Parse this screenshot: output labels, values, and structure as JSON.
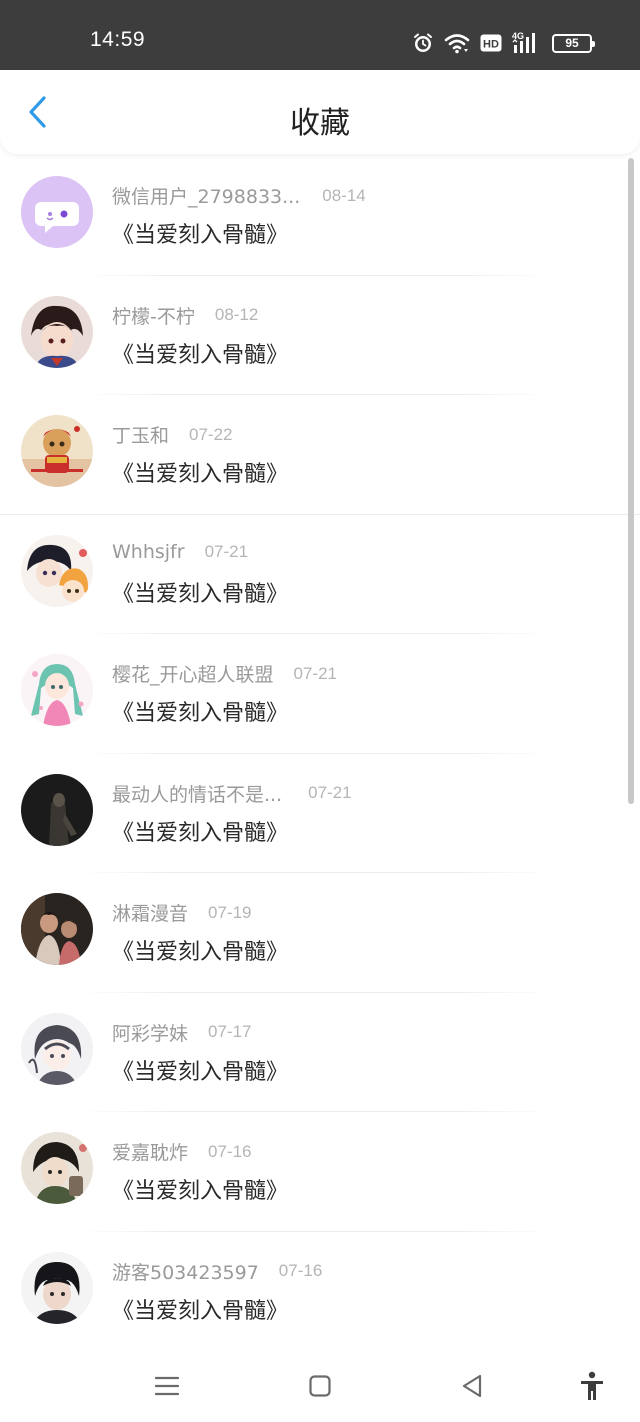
{
  "status_bar": {
    "time": "14:59",
    "battery": "95",
    "network": "4G",
    "hd_label": "HD",
    "icons": [
      "alarm-icon",
      "wifi-icon",
      "hd-icon",
      "signal-4g-icon",
      "battery-icon"
    ]
  },
  "header": {
    "title": "收藏",
    "back_icon": "chevron-left-icon",
    "accent_color": "#2f9be8"
  },
  "list": {
    "items": [
      {
        "username": "微信用户_2798833...",
        "date": "08-14",
        "content": "《当爱刻入骨髓》",
        "avatar": "purple-chat-bubble-avatar"
      },
      {
        "username": "柠檬-不柠",
        "date": "08-12",
        "content": "《当爱刻入骨髓》",
        "avatar": "anime-boy-avatar"
      },
      {
        "username": "丁玉和",
        "date": "07-22",
        "content": "《当爱刻入骨髓》",
        "avatar": "monkey-king-avatar"
      },
      {
        "username": "Whhsjfr",
        "date": "07-21",
        "content": "《当爱刻入骨髓》",
        "avatar": "anime-couple-avatar"
      },
      {
        "username": "樱花_开心超人联盟",
        "date": "07-21",
        "content": "《当爱刻入骨髓》",
        "avatar": "anime-girl-green-hair-avatar"
      },
      {
        "username": "最动人的情话不是...",
        "date": "07-21",
        "content": "《当爱刻入骨髓》",
        "avatar": "dark-photo-avatar"
      },
      {
        "username": "淋霜漫音",
        "date": "07-19",
        "content": "《当爱刻入骨髓》",
        "avatar": "couple-photo-avatar"
      },
      {
        "username": "阿彩学妹",
        "date": "07-17",
        "content": "《当爱刻入骨髓》",
        "avatar": "sketch-girl-avatar"
      },
      {
        "username": "爱嘉耽炸",
        "date": "07-16",
        "content": "《当爱刻入骨髓》",
        "avatar": "anime-boy-dark-avatar"
      },
      {
        "username": "游客503423597",
        "date": "07-16",
        "content": "《当爱刻入骨髓》",
        "avatar": "boy-photo-avatar"
      }
    ]
  },
  "nav_bar": {
    "icons": [
      "menu-icon",
      "home-square-icon",
      "back-triangle-icon",
      "accessibility-icon"
    ]
  }
}
